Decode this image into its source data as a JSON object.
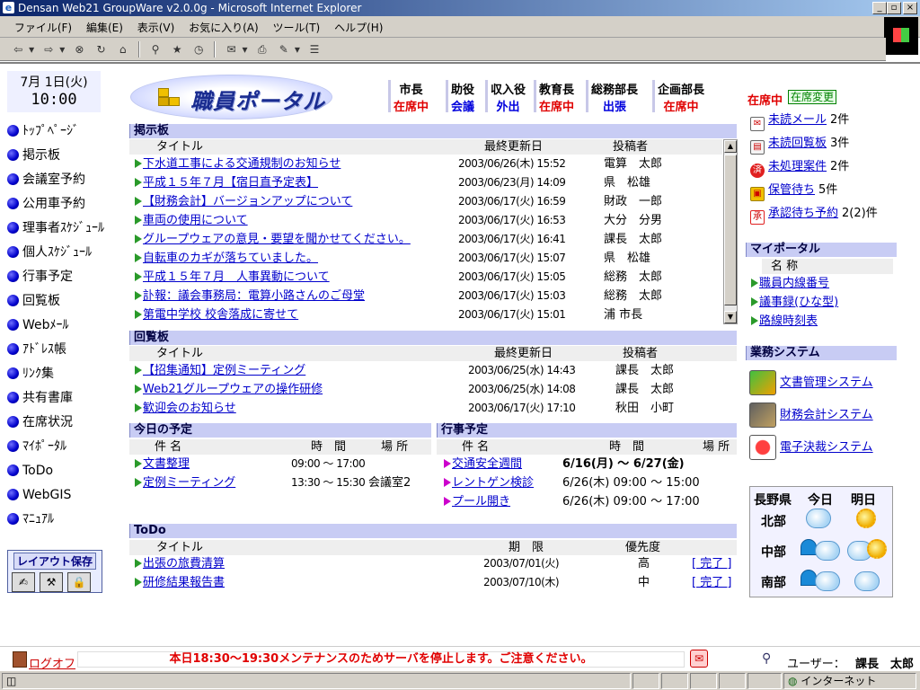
{
  "window": {
    "title": "Densan Web21 GroupWare v2.0.0g - Microsoft Internet Explorer"
  },
  "menu": [
    "ファイル(F)",
    "編集(E)",
    "表示(V)",
    "お気に入り(A)",
    "ツール(T)",
    "ヘルプ(H)"
  ],
  "date": {
    "day": "7月 1日(火)",
    "time": "10:00"
  },
  "nav": [
    "ﾄｯﾌﾟﾍﾟｰｼﾞ",
    "掲示板",
    "会議室予約",
    "公用車予約",
    "理事者ｽｹｼﾞｭｰﾙ",
    "個人ｽｹｼﾞｭｰﾙ",
    "行事予定",
    "回覧板",
    "Webﾒｰﾙ",
    "ｱﾄﾞﾚｽ帳",
    "ﾘﾝｸ集",
    "共有書庫",
    "在席状況",
    "ﾏｲﾎﾟｰﾀﾙ",
    "ToDo",
    "WebGIS",
    "ﾏﾆｭｱﾙ"
  ],
  "layout_save": "レイアウト保存",
  "logo_text": "職員ポータル",
  "executives": [
    {
      "role": "市長",
      "status": "在席中",
      "color": "#e00000"
    },
    {
      "role": "助役",
      "status": "会議",
      "color": "#0000dd"
    },
    {
      "role": "収入役",
      "status": "外出",
      "color": "#0000dd"
    },
    {
      "role": "教育長",
      "status": "在席中",
      "color": "#e00000"
    },
    {
      "role": "総務部長",
      "status": "出張",
      "color": "#0000dd"
    },
    {
      "role": "企画部長",
      "status": "在席中",
      "color": "#e00000"
    }
  ],
  "bulletin": {
    "title": "掲示板",
    "cols": {
      "title": "タイトル",
      "updated": "最終更新日",
      "poster": "投稿者"
    },
    "rows": [
      {
        "title": "下水道工事による交通規制のお知らせ",
        "date": "2003/06/26(木) 15:52",
        "poster": "電算　太郎"
      },
      {
        "title": "平成１５年７月【宿日直予定表】",
        "date": "2003/06/23(月) 14:09",
        "poster": "県　松雄"
      },
      {
        "title": "【財務会計】バージョンアップについて",
        "date": "2003/06/17(火) 16:59",
        "poster": "財政　一郎"
      },
      {
        "title": "車両の使用について",
        "date": "2003/06/17(火) 16:53",
        "poster": "大分　分男"
      },
      {
        "title": "グループウェアの意見・要望を聞かせてください。",
        "date": "2003/06/17(火) 16:41",
        "poster": "課長　太郎"
      },
      {
        "title": "自転車のカギが落ちていました。",
        "date": "2003/06/17(火) 15:07",
        "poster": "県　松雄"
      },
      {
        "title": "平成１５年７月　人事異動について",
        "date": "2003/06/17(火) 15:05",
        "poster": "総務　太郎"
      },
      {
        "title": "訃報：議会事務局：電算小路さんのご母堂",
        "date": "2003/06/17(火) 15:03",
        "poster": "総務　太郎"
      },
      {
        "title": "第電中学校 校舎落成に寄せて",
        "date": "2003/06/17(火) 15:01",
        "poster": "浦 市長"
      }
    ]
  },
  "circular": {
    "title": "回覧板",
    "cols": {
      "title": "タイトル",
      "updated": "最終更新日",
      "poster": "投稿者"
    },
    "rows": [
      {
        "title": "【招集通知】定例ミーティング",
        "date": "2003/06/25(水) 14:43",
        "poster": "課長　太郎"
      },
      {
        "title": "Web21グループウェアの操作研修",
        "date": "2003/06/25(水) 14:08",
        "poster": "課長　太郎"
      },
      {
        "title": "歓迎会のお知らせ",
        "date": "2003/06/17(火) 17:10",
        "poster": "秋田　小町"
      }
    ]
  },
  "today": {
    "title": "今日の予定",
    "cols": {
      "name": "件 名",
      "time": "時　間",
      "place": "場 所"
    },
    "rows": [
      {
        "name": "文書整理",
        "time": "09:00 ～ 17:00",
        "place": ""
      },
      {
        "name": "定例ミーティング",
        "time": "13:30 ～ 15:30",
        "place": "会議室2"
      }
    ]
  },
  "events": {
    "title": "行事予定",
    "cols": {
      "name": "件 名",
      "time": "時　間",
      "place": "場 所"
    },
    "rows": [
      {
        "name": "交通安全週間",
        "time": "6/16(月) ～ 6/27(金)"
      },
      {
        "name": "レントゲン検診",
        "time": "6/26(木) 09:00 ～ 15:00"
      },
      {
        "name": "プール開き",
        "time": "6/26(木) 09:00 ～ 17:00"
      }
    ]
  },
  "todo": {
    "title": "ToDo",
    "cols": {
      "title": "タイトル",
      "due": "期　限",
      "priority": "優先度"
    },
    "rows": [
      {
        "title": "出張の旅費清算",
        "due": "2003/07/01(火)",
        "priority": "高",
        "action": "[ 完了 ]"
      },
      {
        "title": "研修結果報告書",
        "due": "2003/07/10(木)",
        "priority": "中",
        "action": "[ 完了 ]"
      }
    ]
  },
  "my_status": {
    "label": "在席中",
    "change": "在席変更"
  },
  "notices": [
    {
      "link": "未読メール",
      "count": "2件"
    },
    {
      "link": "未読回覧板",
      "count": "3件"
    },
    {
      "link": "未処理案件",
      "count": "2件"
    },
    {
      "link": "保管待ち",
      "count": "5件"
    },
    {
      "link": "承認待ち予約",
      "count": "2(2)件"
    }
  ],
  "myportal": {
    "title": "マイポータル",
    "col": "名 称",
    "items": [
      "職員内線番号",
      "議事録(ひな型)",
      "路線時刻表"
    ]
  },
  "systems": {
    "title": "業務システム",
    "items": [
      "文書管理システム",
      "財務会計システム",
      "電子決裁システム"
    ]
  },
  "weather": {
    "pref": "長野県",
    "today": "今日",
    "tomorrow": "明日",
    "regions": [
      "北部",
      "中部",
      "南部"
    ]
  },
  "footer": {
    "logoff": "ログオフ",
    "message": "本日18:30～19:30メンテナンスのためサーバを停止します。ご注意ください。",
    "user_label": "ユーザー：",
    "user_name": "課長　太郎"
  },
  "statusbar": {
    "zone": "インターネット"
  }
}
